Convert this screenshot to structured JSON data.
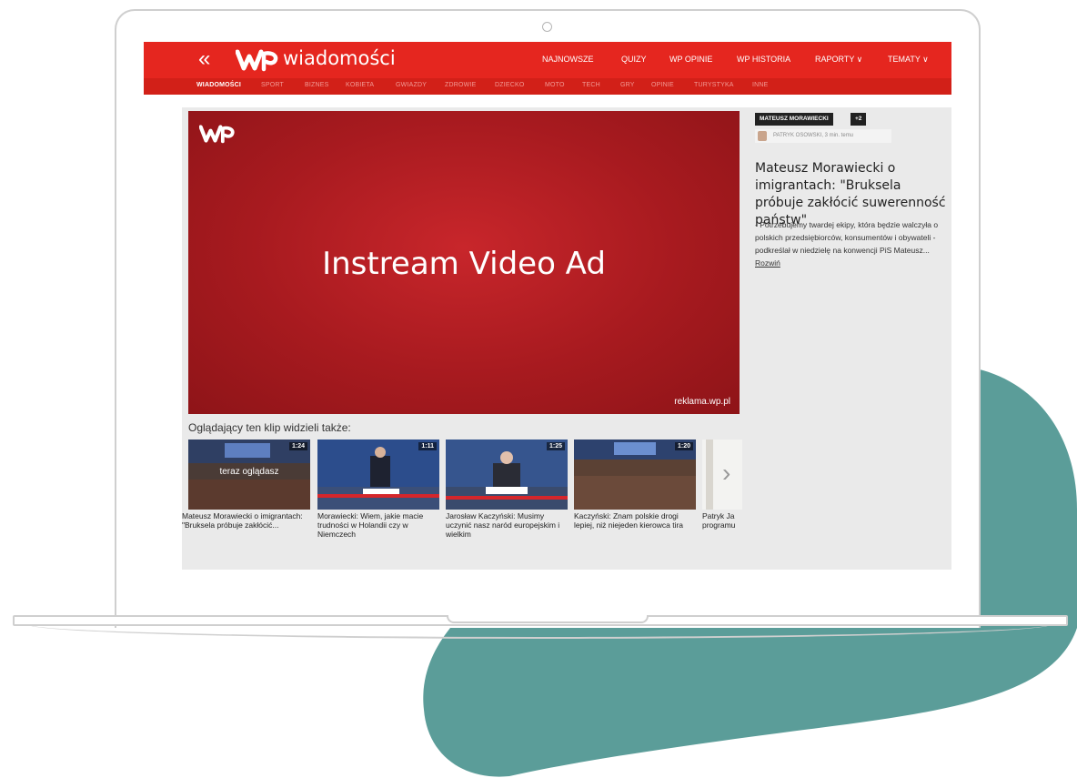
{
  "colors": {
    "brand_red": "#e5261f",
    "teal": "#5b9d99"
  },
  "site": {
    "logo_text": "wiadomości",
    "nav": [
      "NAJNOWSZE",
      "QUIZY",
      "WP OPINIE",
      "WP HISTORIA",
      "RAPORTY ∨",
      "TEMATY ∨"
    ],
    "subnav": [
      "WIADOMOŚCI",
      "SPORT",
      "BIZNES",
      "KOBIETA",
      "GWIAZDY",
      "ZDROWIE",
      "DZIECKO",
      "MOTO",
      "TECH",
      "GRY",
      "OPINIE",
      "TURYSTYKA",
      "INNE"
    ]
  },
  "video": {
    "title": "Instream Video Ad",
    "domain": "reklama.wp.pl"
  },
  "related": {
    "heading": "Oglądający ten klip widzieli także:",
    "now_playing": "teraz oglądasz",
    "items": [
      {
        "duration": "1:24",
        "caption": "Mateusz Morawiecki o imigrantach: \"Bruksela próbuje zakłócić..."
      },
      {
        "duration": "1:11",
        "caption": "Morawiecki: Wiem, jakie macie trudności w Holandii czy w Niemczech"
      },
      {
        "duration": "1:25",
        "caption": "Jarosław Kaczyński: Musimy uczynić nasz naród europejskim i wielkim"
      },
      {
        "duration": "1:20",
        "caption": "Kaczyński: Znam polskie drogi lepiej, niż niejeden kierowca tira"
      },
      {
        "duration": "",
        "caption": "Patryk Ja programu"
      }
    ]
  },
  "article": {
    "tag": "MATEUSZ MORAWIECKI",
    "tag_more": "+2",
    "author": "PATRYK OSOWSKI, 3 min. temu",
    "headline": "Mateusz Morawiecki o imigrantach: \"Bruksela próbuje zakłócić suwerenność państw\"",
    "lead": "- Potrzebujemy twardej ekipy, która będzie walczyła o polskich przedsiębiorców, konsumentów i obywateli - podkreślał w niedzielę na konwencji PiS Mateusz...",
    "more": "Rozwiń"
  }
}
